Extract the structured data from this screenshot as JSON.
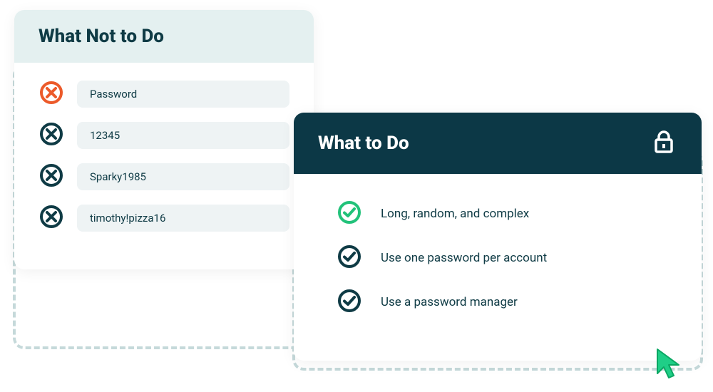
{
  "colors": {
    "teal_dark": "#0c3846",
    "teal_text": "#0f3b45",
    "orange": "#ec5a2a",
    "green": "#22c27a",
    "pale_bg": "#e4f0f0",
    "pill_bg": "#eef3f4",
    "dashed": "#c5d9da"
  },
  "not_card": {
    "title": "What Not to Do",
    "items": [
      {
        "label": "Password",
        "highlight": true
      },
      {
        "label": "12345",
        "highlight": false
      },
      {
        "label": "Sparky1985",
        "highlight": false
      },
      {
        "label": "timothy!pizza16",
        "highlight": false
      }
    ]
  },
  "do_card": {
    "title": "What to Do",
    "items": [
      {
        "label": "Long, random, and complex",
        "highlight": true
      },
      {
        "label": "Use one password per account",
        "highlight": false
      },
      {
        "label": "Use a password manager",
        "highlight": false
      }
    ]
  }
}
